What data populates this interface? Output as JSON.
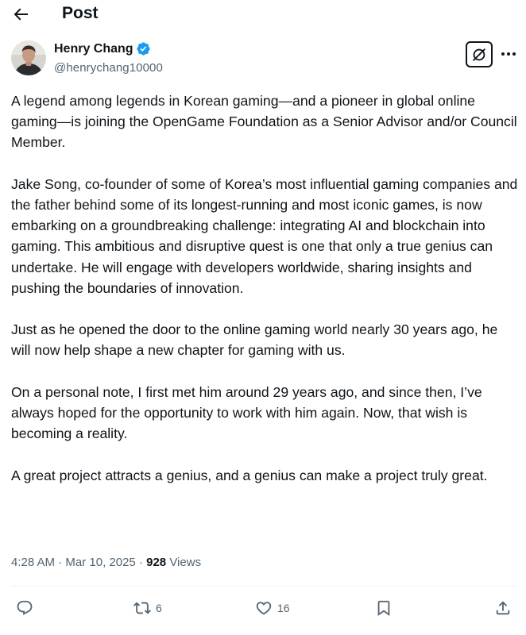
{
  "header": {
    "title": "Post"
  },
  "author": {
    "name": "Henry Chang",
    "handle": "@henrychang10000",
    "verified": true
  },
  "post": {
    "paragraphs": [
      "A legend among legends in Korean gaming—and a pioneer in global online gaming—is joining the OpenGame Foundation as a Senior Advisor and/or Council Member.",
      "Jake Song, co-founder of some of Korea’s most influential gaming companies and the father behind some of its longest-running and most iconic games, is now embarking on a groundbreaking challenge: integrating AI and blockchain into gaming. This ambitious and disruptive quest is one that only a true genius can undertake. He will engage with developers worldwide, sharing insights and pushing the boundaries of innovation.",
      "Just as he opened the door to the online gaming world nearly 30 years ago, he will now help shape a new chapter for gaming with us.",
      "On a personal note, I first met him around 29 years ago, and since then, I’ve always hoped for the opportunity to work with him again. Now, that wish is becoming a reality.",
      "A great project attracts a genius, and a genius can make a project truly great."
    ],
    "time": "4:28 AM",
    "separator": "·",
    "date": "Mar 10, 2025",
    "views_count": "928",
    "views_label": "Views"
  },
  "actions": {
    "reply_count": "",
    "repost_count": "6",
    "like_count": "16"
  },
  "colors": {
    "text": "#0f1419",
    "secondary": "#536471",
    "verified": "#1d9bf0",
    "divider": "#eff3f4"
  },
  "icons": {
    "back": "arrow-left-icon",
    "verified": "verified-badge-icon",
    "grok": "grok-icon",
    "more": "more-horizontal-icon",
    "reply": "reply-icon",
    "repost": "repost-icon",
    "like": "heart-icon",
    "bookmark": "bookmark-icon",
    "share": "share-icon"
  }
}
